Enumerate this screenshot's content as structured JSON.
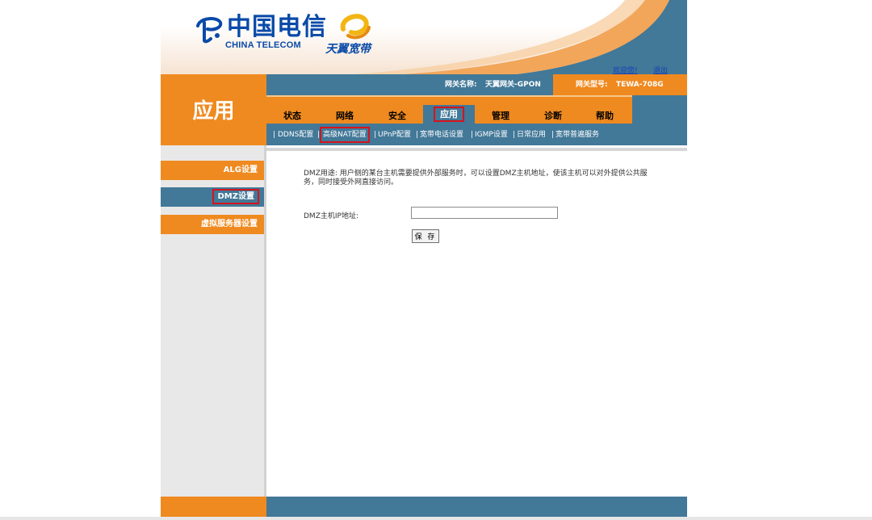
{
  "brand": {
    "telecom_cn": "中国电信",
    "telecom_en": "CHINA TELECOM",
    "broadband": "天翼宽带"
  },
  "top_links": {
    "welcome": "欢迎您!",
    "logout": "退出"
  },
  "app_title": "应用",
  "info": {
    "gateway_name_label": "网关名称:",
    "gateway_name_value": "天翼网关-GPON",
    "gateway_model_label": "网关型号:",
    "gateway_model_value": "TEWA-708G"
  },
  "tabs": [
    {
      "label": "状态"
    },
    {
      "label": "网络"
    },
    {
      "label": "安全"
    },
    {
      "label": "应用",
      "active": true
    },
    {
      "label": "管理"
    },
    {
      "label": "诊断"
    },
    {
      "label": "帮助"
    }
  ],
  "subtabs": [
    {
      "label": "DDNS配置"
    },
    {
      "label": "高级NAT配置",
      "active": true
    },
    {
      "label": "UPnP配置"
    },
    {
      "label": "宽带电话设置"
    },
    {
      "label": "IGMP设置"
    },
    {
      "label": "日常应用"
    },
    {
      "label": "宽带普遍服务"
    }
  ],
  "left_nav": [
    {
      "label": "ALG设置"
    },
    {
      "label": "DMZ设置",
      "active": true
    },
    {
      "label": "虚拟服务器设置"
    }
  ],
  "content": {
    "description": "DMZ用途: 用户侧的某台主机需要提供外部服务时，可以设置DMZ主机地址，使该主机可以对外提供公共服务，同时接受外网直接访问。",
    "ip_label": "DMZ主机IP地址:",
    "ip_value": "",
    "save_label": "保 存"
  },
  "colors": {
    "orange": "#ef8a20",
    "blue": "#427898",
    "highlight": "#d4141c",
    "logo_blue": "#0a4aa8"
  }
}
